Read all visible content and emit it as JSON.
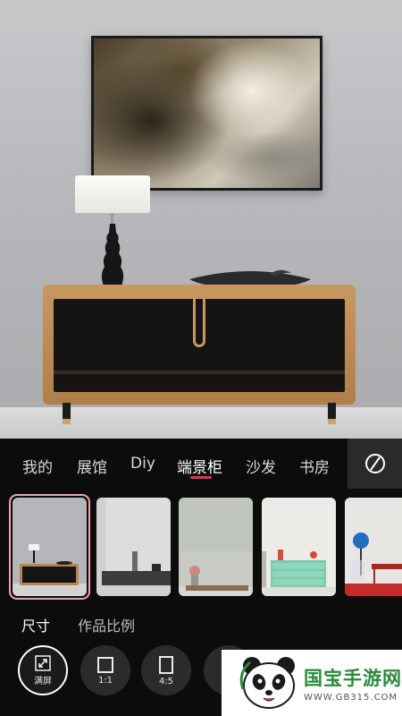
{
  "tabs": [
    {
      "label": "我的",
      "active": false
    },
    {
      "label": "展馆",
      "active": false
    },
    {
      "label": "Diy",
      "active": false
    },
    {
      "label": "端景柜",
      "active": true
    },
    {
      "label": "沙发",
      "active": false
    },
    {
      "label": "书房",
      "active": false
    }
  ],
  "clear_icon": "no-image-icon",
  "thumbnails": [
    {
      "scene": "console-cabinet",
      "selected": true
    },
    {
      "scene": "grey-sideboard",
      "selected": false
    },
    {
      "scene": "wood-bench-vase",
      "selected": false
    },
    {
      "scene": "mint-drawer-chest",
      "selected": false
    },
    {
      "scene": "red-chair-lamp",
      "selected": false
    }
  ],
  "sections": {
    "size": "尺寸",
    "ratio": "作品比例"
  },
  "size_options": [
    {
      "label": "满屏",
      "icon": "expand-icon",
      "active": true
    },
    {
      "label": "1:1",
      "icon": "square-icon",
      "active": false
    },
    {
      "label": "4:5",
      "icon": "portrait-rect-icon",
      "active": false
    }
  ],
  "watermark": {
    "title": "国宝手游网",
    "url": "WWW.GB315.COM"
  },
  "colors": {
    "accent": "#e3334a",
    "selection": "#f0a3aa",
    "watermark_green": "#2a8a3a"
  }
}
